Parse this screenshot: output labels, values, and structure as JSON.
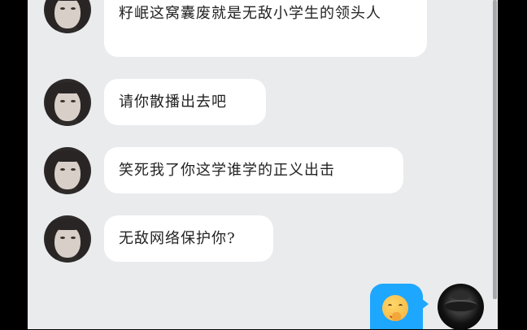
{
  "messages": [
    {
      "sender": "contact",
      "text": "籽岷这窝囊废就是无敌小学生的领头人"
    },
    {
      "sender": "contact",
      "text": "请你散播出去吧"
    },
    {
      "sender": "contact",
      "text": "笑死我了你这学谁学的正义出击"
    },
    {
      "sender": "contact",
      "text": "无敌网络保护你?"
    }
  ],
  "sent_message": {
    "type": "emoji",
    "icon": "fist-to-mouth-emoji-icon"
  },
  "colors": {
    "chat_background": "#eaebed",
    "received_bubble": "#ffffff",
    "sent_bubble": "#1ea7ff"
  }
}
